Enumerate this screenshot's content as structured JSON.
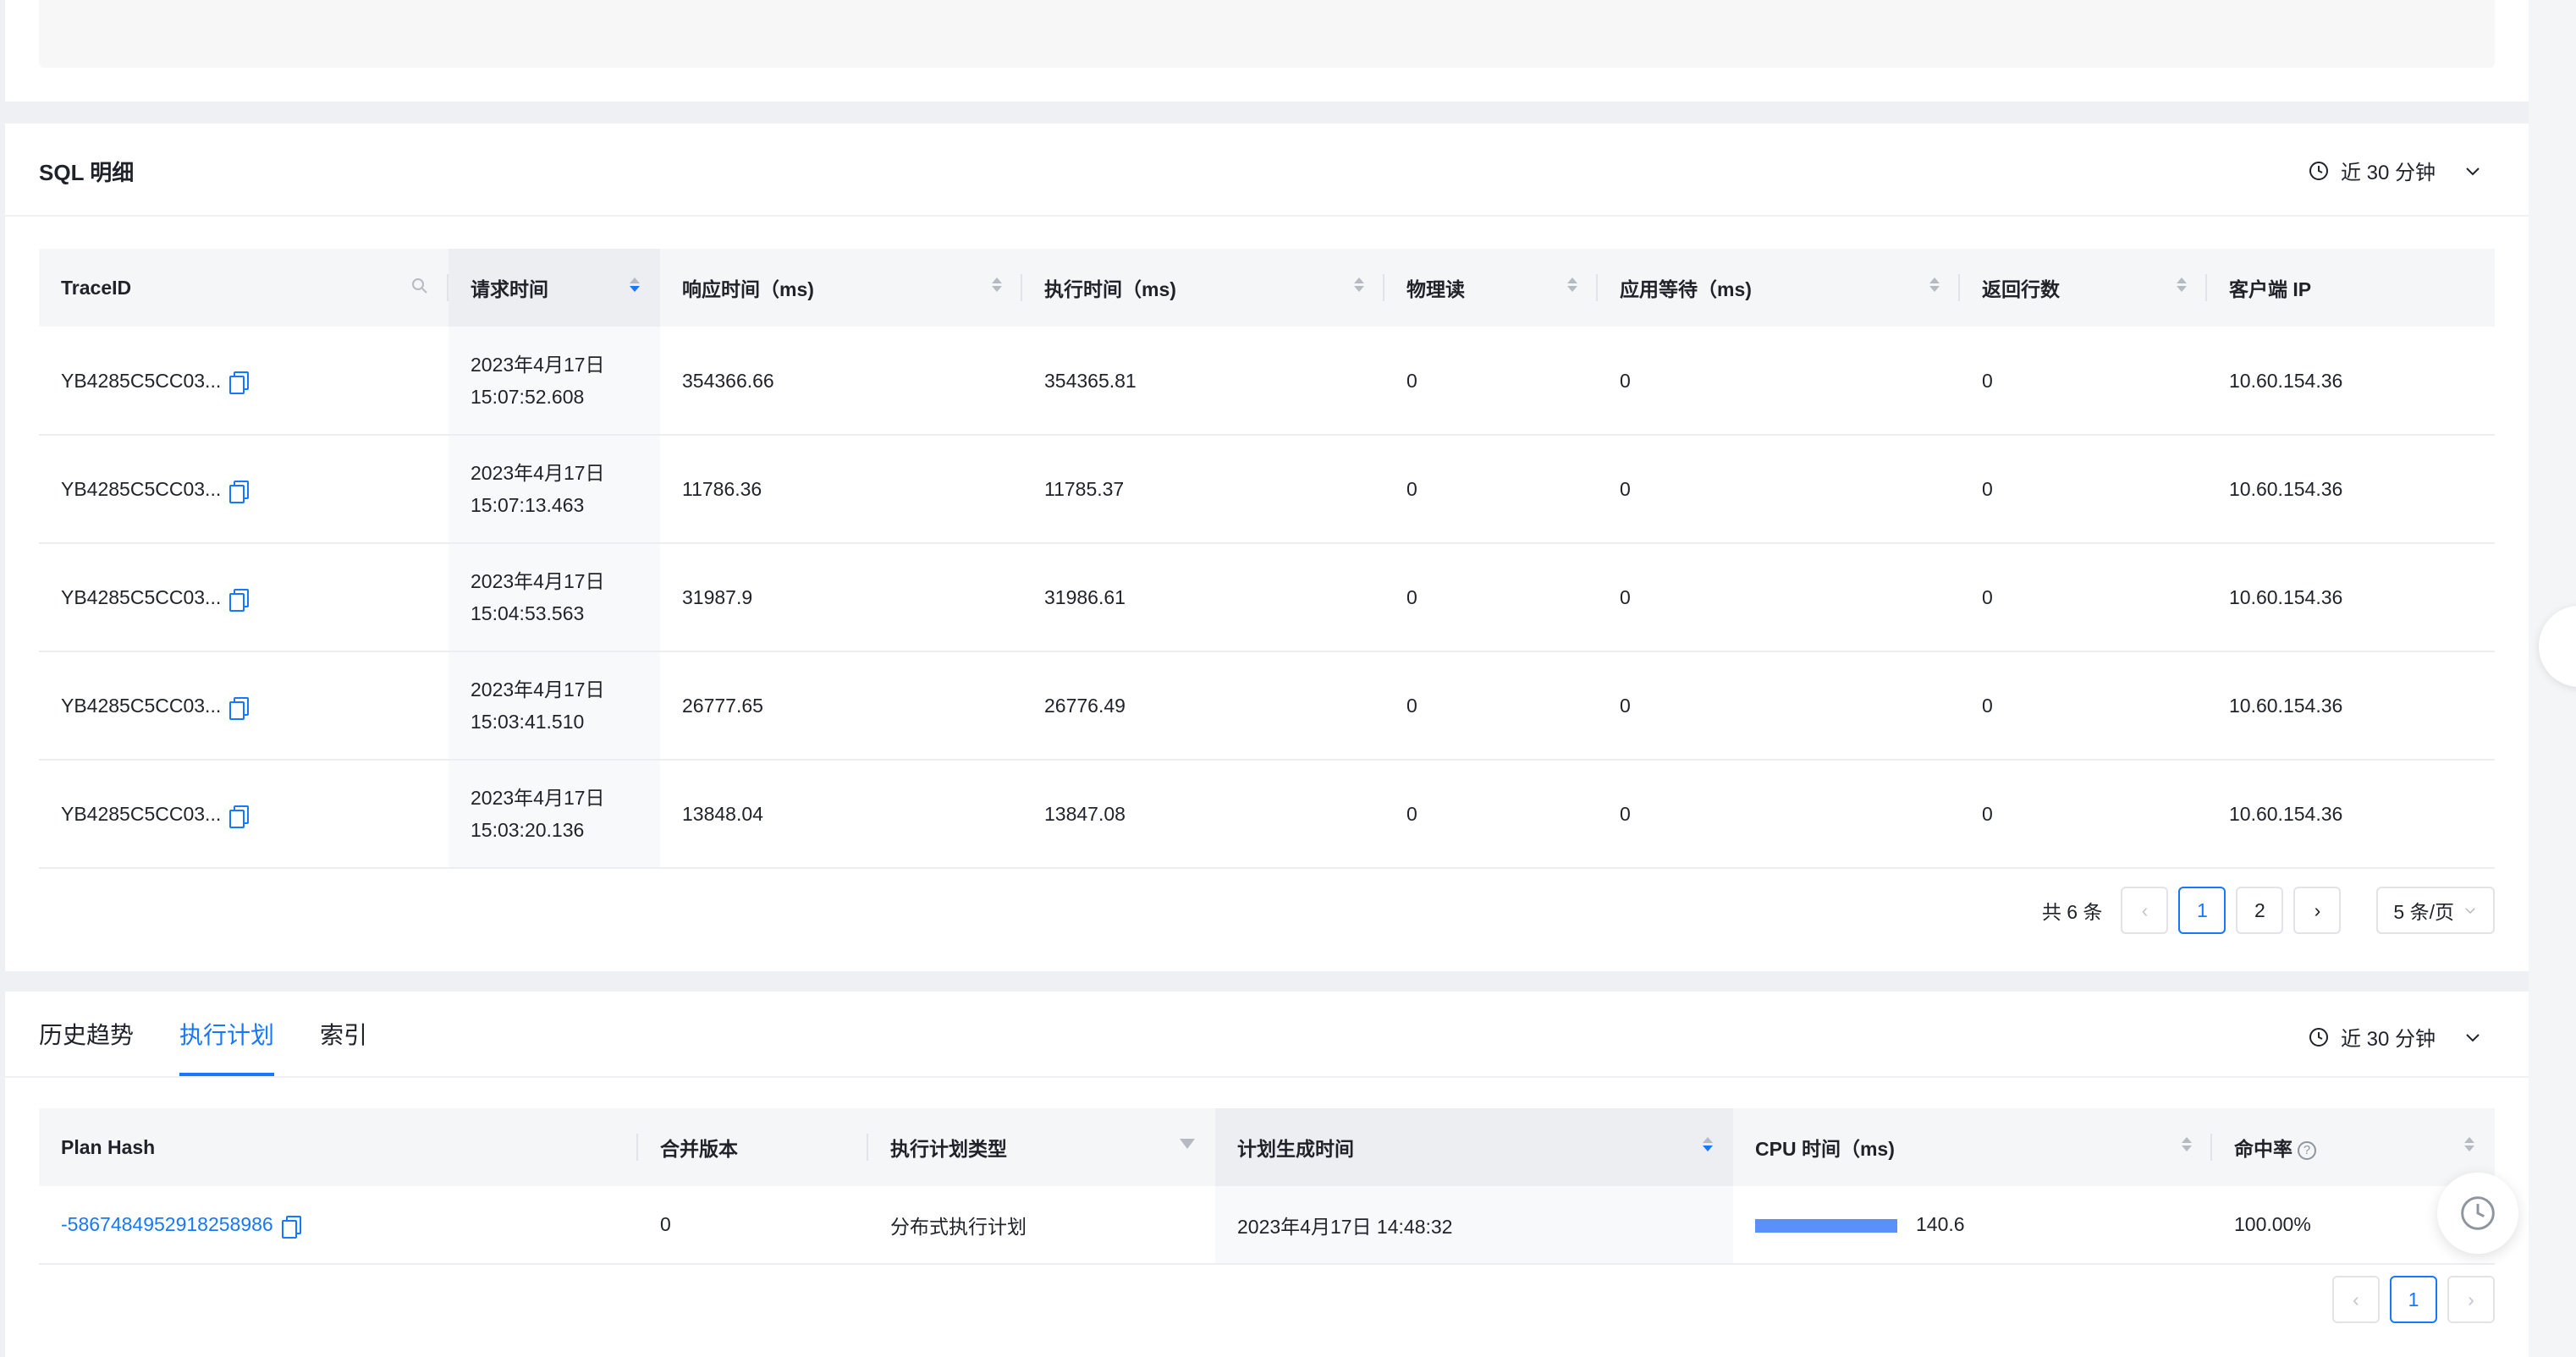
{
  "sql_panel": {
    "title": "SQL 明细",
    "time_range": "近 30 分钟",
    "columns": [
      "TraceID",
      "请求时间",
      "响应时间（ms)",
      "执行时间（ms)",
      "物理读",
      "应用等待（ms)",
      "返回行数",
      "客户端 IP"
    ],
    "rows": [
      {
        "trace_id": "YB4285C5CC03...",
        "date": "2023年4月17日",
        "time": "15:07:52.608",
        "response": "354366.66",
        "exec": "354365.81",
        "phys_reads": "0",
        "app_wait": "0",
        "rows_returned": "0",
        "client_ip": "10.60.154.36"
      },
      {
        "trace_id": "YB4285C5CC03...",
        "date": "2023年4月17日",
        "time": "15:07:13.463",
        "response": "11786.36",
        "exec": "11785.37",
        "phys_reads": "0",
        "app_wait": "0",
        "rows_returned": "0",
        "client_ip": "10.60.154.36"
      },
      {
        "trace_id": "YB4285C5CC03...",
        "date": "2023年4月17日",
        "time": "15:04:53.563",
        "response": "31987.9",
        "exec": "31986.61",
        "phys_reads": "0",
        "app_wait": "0",
        "rows_returned": "0",
        "client_ip": "10.60.154.36"
      },
      {
        "trace_id": "YB4285C5CC03...",
        "date": "2023年4月17日",
        "time": "15:03:41.510",
        "response": "26777.65",
        "exec": "26776.49",
        "phys_reads": "0",
        "app_wait": "0",
        "rows_returned": "0",
        "client_ip": "10.60.154.36"
      },
      {
        "trace_id": "YB4285C5CC03...",
        "date": "2023年4月17日",
        "time": "15:03:20.136",
        "response": "13848.04",
        "exec": "13847.08",
        "phys_reads": "0",
        "app_wait": "0",
        "rows_returned": "0",
        "client_ip": "10.60.154.36"
      }
    ],
    "pagination": {
      "total": "共 6 条",
      "pages": [
        "1",
        "2"
      ],
      "current": "1",
      "page_size": "5 条/页"
    }
  },
  "plan_panel": {
    "tabs": [
      "历史趋势",
      "执行计划",
      "索引"
    ],
    "active_tab": "执行计划",
    "time_range": "近 30 分钟",
    "columns": [
      "Plan Hash",
      "合并版本",
      "执行计划类型",
      "计划生成时间",
      "CPU 时间（ms)",
      "命中率"
    ],
    "rows": [
      {
        "plan_hash": "-5867484952918258986",
        "merged_version": "0",
        "plan_type": "分布式执行计划",
        "generated_at": "2023年4月17日 14:48:32",
        "cpu_time": "140.6",
        "cpu_fraction": 1.0,
        "hit_rate": "100.00%"
      }
    ],
    "pagination": {
      "current": "1"
    }
  },
  "icons": {
    "clock": "clock-icon",
    "chevron": "chevron-down-icon",
    "copy": "copy-icon",
    "search": "search-icon",
    "filter": "filter-icon",
    "help": "help-icon"
  },
  "colors": {
    "accent": "#1677ff",
    "bar": "#5b8ff9"
  }
}
